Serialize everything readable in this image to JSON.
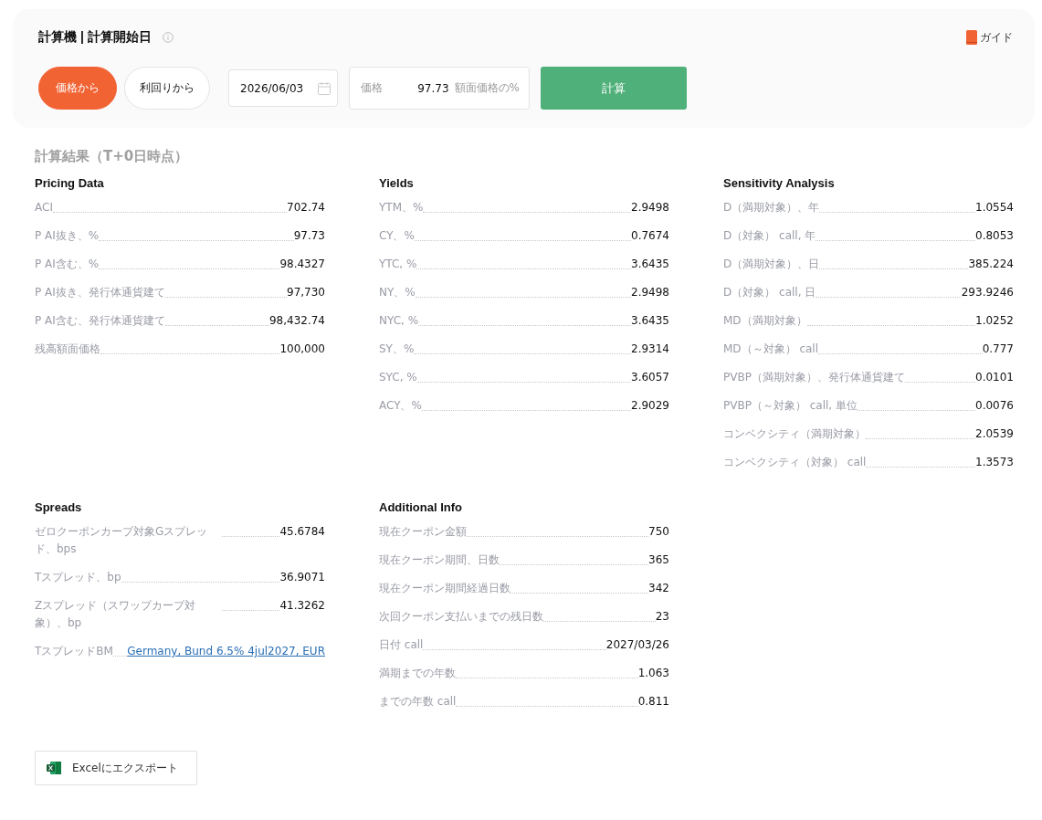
{
  "header": {
    "title": "計算機 | 計算開始日",
    "guide": "ガイド"
  },
  "mode_buttons": [
    {
      "label": "価格から",
      "selected": true
    },
    {
      "label": "利回りから",
      "selected": false
    }
  ],
  "date_field": {
    "value": "2026/06/03"
  },
  "price_field": {
    "label": "価格",
    "value": "97.73",
    "suffix": "額面価格の%"
  },
  "calculate_button": "計算",
  "results": {
    "title": "計算結果（T+0日時点）",
    "sections": [
      {
        "title": "Pricing Data",
        "rows": [
          {
            "label": "ACI",
            "value": "702.74",
            "kind": "number"
          },
          {
            "label": "P AI抜き、%",
            "value": "97.73",
            "kind": "number"
          },
          {
            "label": "P AI含む、%",
            "value": "98.4327",
            "kind": "number"
          },
          {
            "label": "P AI抜き、発行体通貨建て",
            "value": "97,730",
            "kind": "number"
          },
          {
            "label": "P AI含む、発行体通貨建て",
            "value": "98,432.74",
            "kind": "number"
          },
          {
            "label": "残高額面価格",
            "value": "100,000",
            "kind": "number"
          }
        ]
      },
      {
        "title": "Yields",
        "rows": [
          {
            "label": "YTM、%",
            "value": "2.9498",
            "kind": "number"
          },
          {
            "label": "CY、%",
            "value": "0.7674",
            "kind": "number"
          },
          {
            "label": "YTC, %",
            "value": "3.6435",
            "kind": "number"
          },
          {
            "label": "NY、%",
            "value": "2.9498",
            "kind": "number"
          },
          {
            "label": "NYC, %",
            "value": "3.6435",
            "kind": "number"
          },
          {
            "label": "SY、%",
            "value": "2.9314",
            "kind": "number"
          },
          {
            "label": "SYC, %",
            "value": "3.6057",
            "kind": "number"
          },
          {
            "label": "ACY、%",
            "value": "2.9029",
            "kind": "number"
          }
        ]
      },
      {
        "title": "Sensitivity Analysis",
        "rows": [
          {
            "label": "D（満期対象）、年",
            "value": "1.0554",
            "kind": "number"
          },
          {
            "label": "D（対象） call, 年",
            "value": "0.8053",
            "kind": "number"
          },
          {
            "label": "D（満期対象）、日",
            "value": "385.224",
            "kind": "number"
          },
          {
            "label": "D（対象） call, 日",
            "value": "293.9246",
            "kind": "number"
          },
          {
            "label": "MD（満期対象）",
            "value": "1.0252",
            "kind": "number"
          },
          {
            "label": "MD（～対象） call",
            "value": "0.777",
            "kind": "number"
          },
          {
            "label": "PVBP（満期対象）、発行体通貨建て",
            "value": "0.0101",
            "kind": "number"
          },
          {
            "label": "PVBP（～対象） call, 単位",
            "value": "0.0076",
            "kind": "number"
          },
          {
            "label": "コンベクシティ（満期対象）",
            "value": "2.0539",
            "kind": "number"
          },
          {
            "label": "コンベクシティ（対象） call",
            "value": "1.3573",
            "kind": "number"
          }
        ]
      },
      {
        "title": "Spreads",
        "rows": [
          {
            "label": "ゼロクーポンカーブ対象Gスプレッド、bps",
            "value": "45.6784",
            "kind": "number"
          },
          {
            "label": "Tスプレッド、bp",
            "value": "36.9071",
            "kind": "number"
          },
          {
            "label": "Zスプレッド（スワップカーブ対象）、bp",
            "value": "41.3262",
            "kind": "number"
          },
          {
            "label": "TスプレッドBM",
            "value": "Germany, Bund 6.5% 4jul2027, EUR",
            "kind": "link"
          }
        ]
      },
      {
        "title": "Additional Info",
        "rows": [
          {
            "label": "現在クーポン金額",
            "value": "750",
            "kind": "number"
          },
          {
            "label": "現在クーポン期間、日数",
            "value": "365",
            "kind": "number"
          },
          {
            "label": "現在クーポン期間経過日数",
            "value": "342",
            "kind": "number"
          },
          {
            "label": "次回クーポン支払いまでの残日数",
            "value": "23",
            "kind": "number"
          },
          {
            "label": "日付 call",
            "value": "2027/03/26",
            "kind": "number"
          },
          {
            "label": "満期までの年数",
            "value": "1.063",
            "kind": "number"
          },
          {
            "label": "までの年数 call",
            "value": "0.811",
            "kind": "number"
          }
        ]
      }
    ]
  },
  "export_button": "Excelにエクスポート"
}
